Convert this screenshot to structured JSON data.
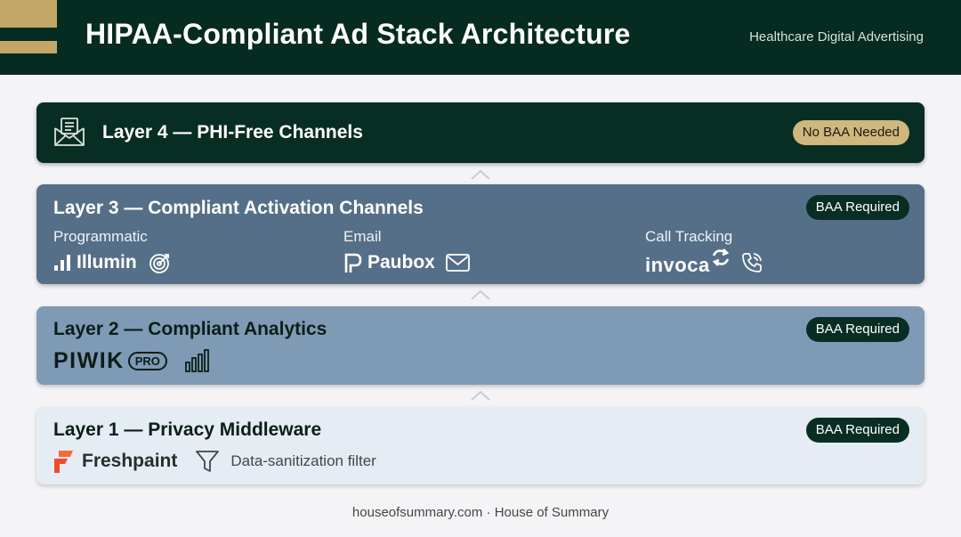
{
  "header": {
    "title": "HIPAA-Compliant Ad Stack Architecture",
    "subtitle": "Healthcare Digital Advertising"
  },
  "layers": [
    {
      "name": "Layer 4 — PHI-Free Channels",
      "badge": "No BAA Needed",
      "icon": "email-newsletter-icon"
    },
    {
      "name": "Layer 3 — Compliant Activation Channels",
      "badge": "BAA Required",
      "columns": [
        {
          "label": "Programmatic",
          "brand": "Illumin",
          "brand_icon": "signal-bars-icon",
          "extra_icon": "target-icon"
        },
        {
          "label": "Email",
          "brand": "Paubox",
          "brand_icon": "paubox-logo-icon",
          "extra_icon": "envelope-icon"
        },
        {
          "label": "Call Tracking",
          "brand": "invoca",
          "brand_icon": "invoca-swirl-icon",
          "extra_icon": "phone-icon"
        }
      ]
    },
    {
      "name": "Layer 2 — Compliant Analytics",
      "badge": "BAA Required",
      "brand": "PIWIK",
      "brand_suffix": "PRO",
      "extra_icon": "bar-chart-icon"
    },
    {
      "name": "Layer 1 — Privacy Middleware",
      "badge": "BAA Required",
      "brand": "Freshpaint",
      "brand_icon": "freshpaint-logo-icon",
      "filter_icon": "funnel-icon",
      "filter_label": "Data-sanitization filter"
    }
  ],
  "footer": {
    "text": "houseofsummary.com · House of Summary"
  },
  "colors": {
    "header_bg": "#062b21",
    "accent_gold": "#c3a769",
    "layer4_bg": "#082e24",
    "layer3_bg": "#566f88",
    "layer2_bg": "#7f9ab5",
    "layer1_bg": "#e5ecf4"
  }
}
